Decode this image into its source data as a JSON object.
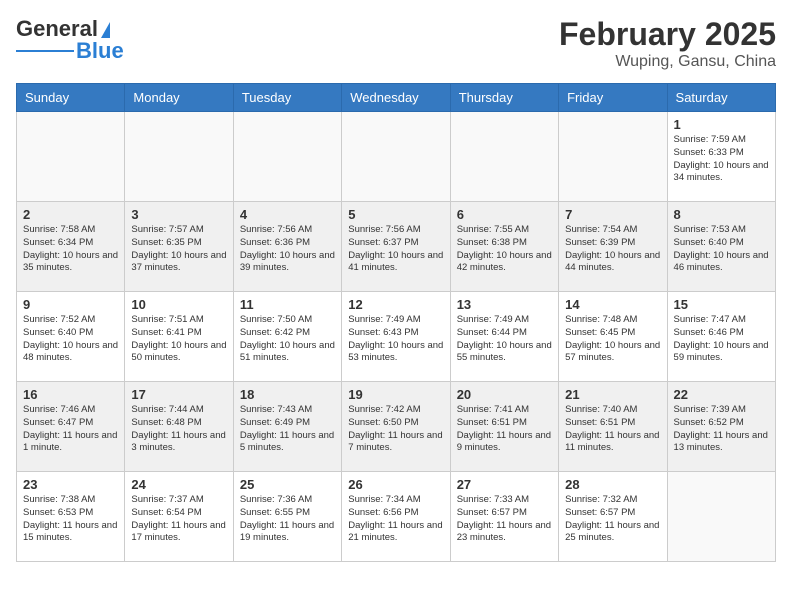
{
  "header": {
    "logo": {
      "line1": "General",
      "line2": "Blue"
    },
    "month_year": "February 2025",
    "location": "Wuping, Gansu, China"
  },
  "days_of_week": [
    "Sunday",
    "Monday",
    "Tuesday",
    "Wednesday",
    "Thursday",
    "Friday",
    "Saturday"
  ],
  "weeks": [
    [
      {
        "day": "",
        "empty": true
      },
      {
        "day": "",
        "empty": true
      },
      {
        "day": "",
        "empty": true
      },
      {
        "day": "",
        "empty": true
      },
      {
        "day": "",
        "empty": true
      },
      {
        "day": "",
        "empty": true
      },
      {
        "day": "1",
        "sunrise": "7:59 AM",
        "sunset": "6:33 PM",
        "daylight": "10 hours and 34 minutes."
      }
    ],
    [
      {
        "day": "2",
        "sunrise": "7:58 AM",
        "sunset": "6:34 PM",
        "daylight": "10 hours and 35 minutes."
      },
      {
        "day": "3",
        "sunrise": "7:57 AM",
        "sunset": "6:35 PM",
        "daylight": "10 hours and 37 minutes."
      },
      {
        "day": "4",
        "sunrise": "7:56 AM",
        "sunset": "6:36 PM",
        "daylight": "10 hours and 39 minutes."
      },
      {
        "day": "5",
        "sunrise": "7:56 AM",
        "sunset": "6:37 PM",
        "daylight": "10 hours and 41 minutes."
      },
      {
        "day": "6",
        "sunrise": "7:55 AM",
        "sunset": "6:38 PM",
        "daylight": "10 hours and 42 minutes."
      },
      {
        "day": "7",
        "sunrise": "7:54 AM",
        "sunset": "6:39 PM",
        "daylight": "10 hours and 44 minutes."
      },
      {
        "day": "8",
        "sunrise": "7:53 AM",
        "sunset": "6:40 PM",
        "daylight": "10 hours and 46 minutes."
      }
    ],
    [
      {
        "day": "9",
        "sunrise": "7:52 AM",
        "sunset": "6:40 PM",
        "daylight": "10 hours and 48 minutes."
      },
      {
        "day": "10",
        "sunrise": "7:51 AM",
        "sunset": "6:41 PM",
        "daylight": "10 hours and 50 minutes."
      },
      {
        "day": "11",
        "sunrise": "7:50 AM",
        "sunset": "6:42 PM",
        "daylight": "10 hours and 51 minutes."
      },
      {
        "day": "12",
        "sunrise": "7:49 AM",
        "sunset": "6:43 PM",
        "daylight": "10 hours and 53 minutes."
      },
      {
        "day": "13",
        "sunrise": "7:49 AM",
        "sunset": "6:44 PM",
        "daylight": "10 hours and 55 minutes."
      },
      {
        "day": "14",
        "sunrise": "7:48 AM",
        "sunset": "6:45 PM",
        "daylight": "10 hours and 57 minutes."
      },
      {
        "day": "15",
        "sunrise": "7:47 AM",
        "sunset": "6:46 PM",
        "daylight": "10 hours and 59 minutes."
      }
    ],
    [
      {
        "day": "16",
        "sunrise": "7:46 AM",
        "sunset": "6:47 PM",
        "daylight": "11 hours and 1 minute."
      },
      {
        "day": "17",
        "sunrise": "7:44 AM",
        "sunset": "6:48 PM",
        "daylight": "11 hours and 3 minutes."
      },
      {
        "day": "18",
        "sunrise": "7:43 AM",
        "sunset": "6:49 PM",
        "daylight": "11 hours and 5 minutes."
      },
      {
        "day": "19",
        "sunrise": "7:42 AM",
        "sunset": "6:50 PM",
        "daylight": "11 hours and 7 minutes."
      },
      {
        "day": "20",
        "sunrise": "7:41 AM",
        "sunset": "6:51 PM",
        "daylight": "11 hours and 9 minutes."
      },
      {
        "day": "21",
        "sunrise": "7:40 AM",
        "sunset": "6:51 PM",
        "daylight": "11 hours and 11 minutes."
      },
      {
        "day": "22",
        "sunrise": "7:39 AM",
        "sunset": "6:52 PM",
        "daylight": "11 hours and 13 minutes."
      }
    ],
    [
      {
        "day": "23",
        "sunrise": "7:38 AM",
        "sunset": "6:53 PM",
        "daylight": "11 hours and 15 minutes."
      },
      {
        "day": "24",
        "sunrise": "7:37 AM",
        "sunset": "6:54 PM",
        "daylight": "11 hours and 17 minutes."
      },
      {
        "day": "25",
        "sunrise": "7:36 AM",
        "sunset": "6:55 PM",
        "daylight": "11 hours and 19 minutes."
      },
      {
        "day": "26",
        "sunrise": "7:34 AM",
        "sunset": "6:56 PM",
        "daylight": "11 hours and 21 minutes."
      },
      {
        "day": "27",
        "sunrise": "7:33 AM",
        "sunset": "6:57 PM",
        "daylight": "11 hours and 23 minutes."
      },
      {
        "day": "28",
        "sunrise": "7:32 AM",
        "sunset": "6:57 PM",
        "daylight": "11 hours and 25 minutes."
      },
      {
        "day": "",
        "empty": true
      }
    ]
  ]
}
